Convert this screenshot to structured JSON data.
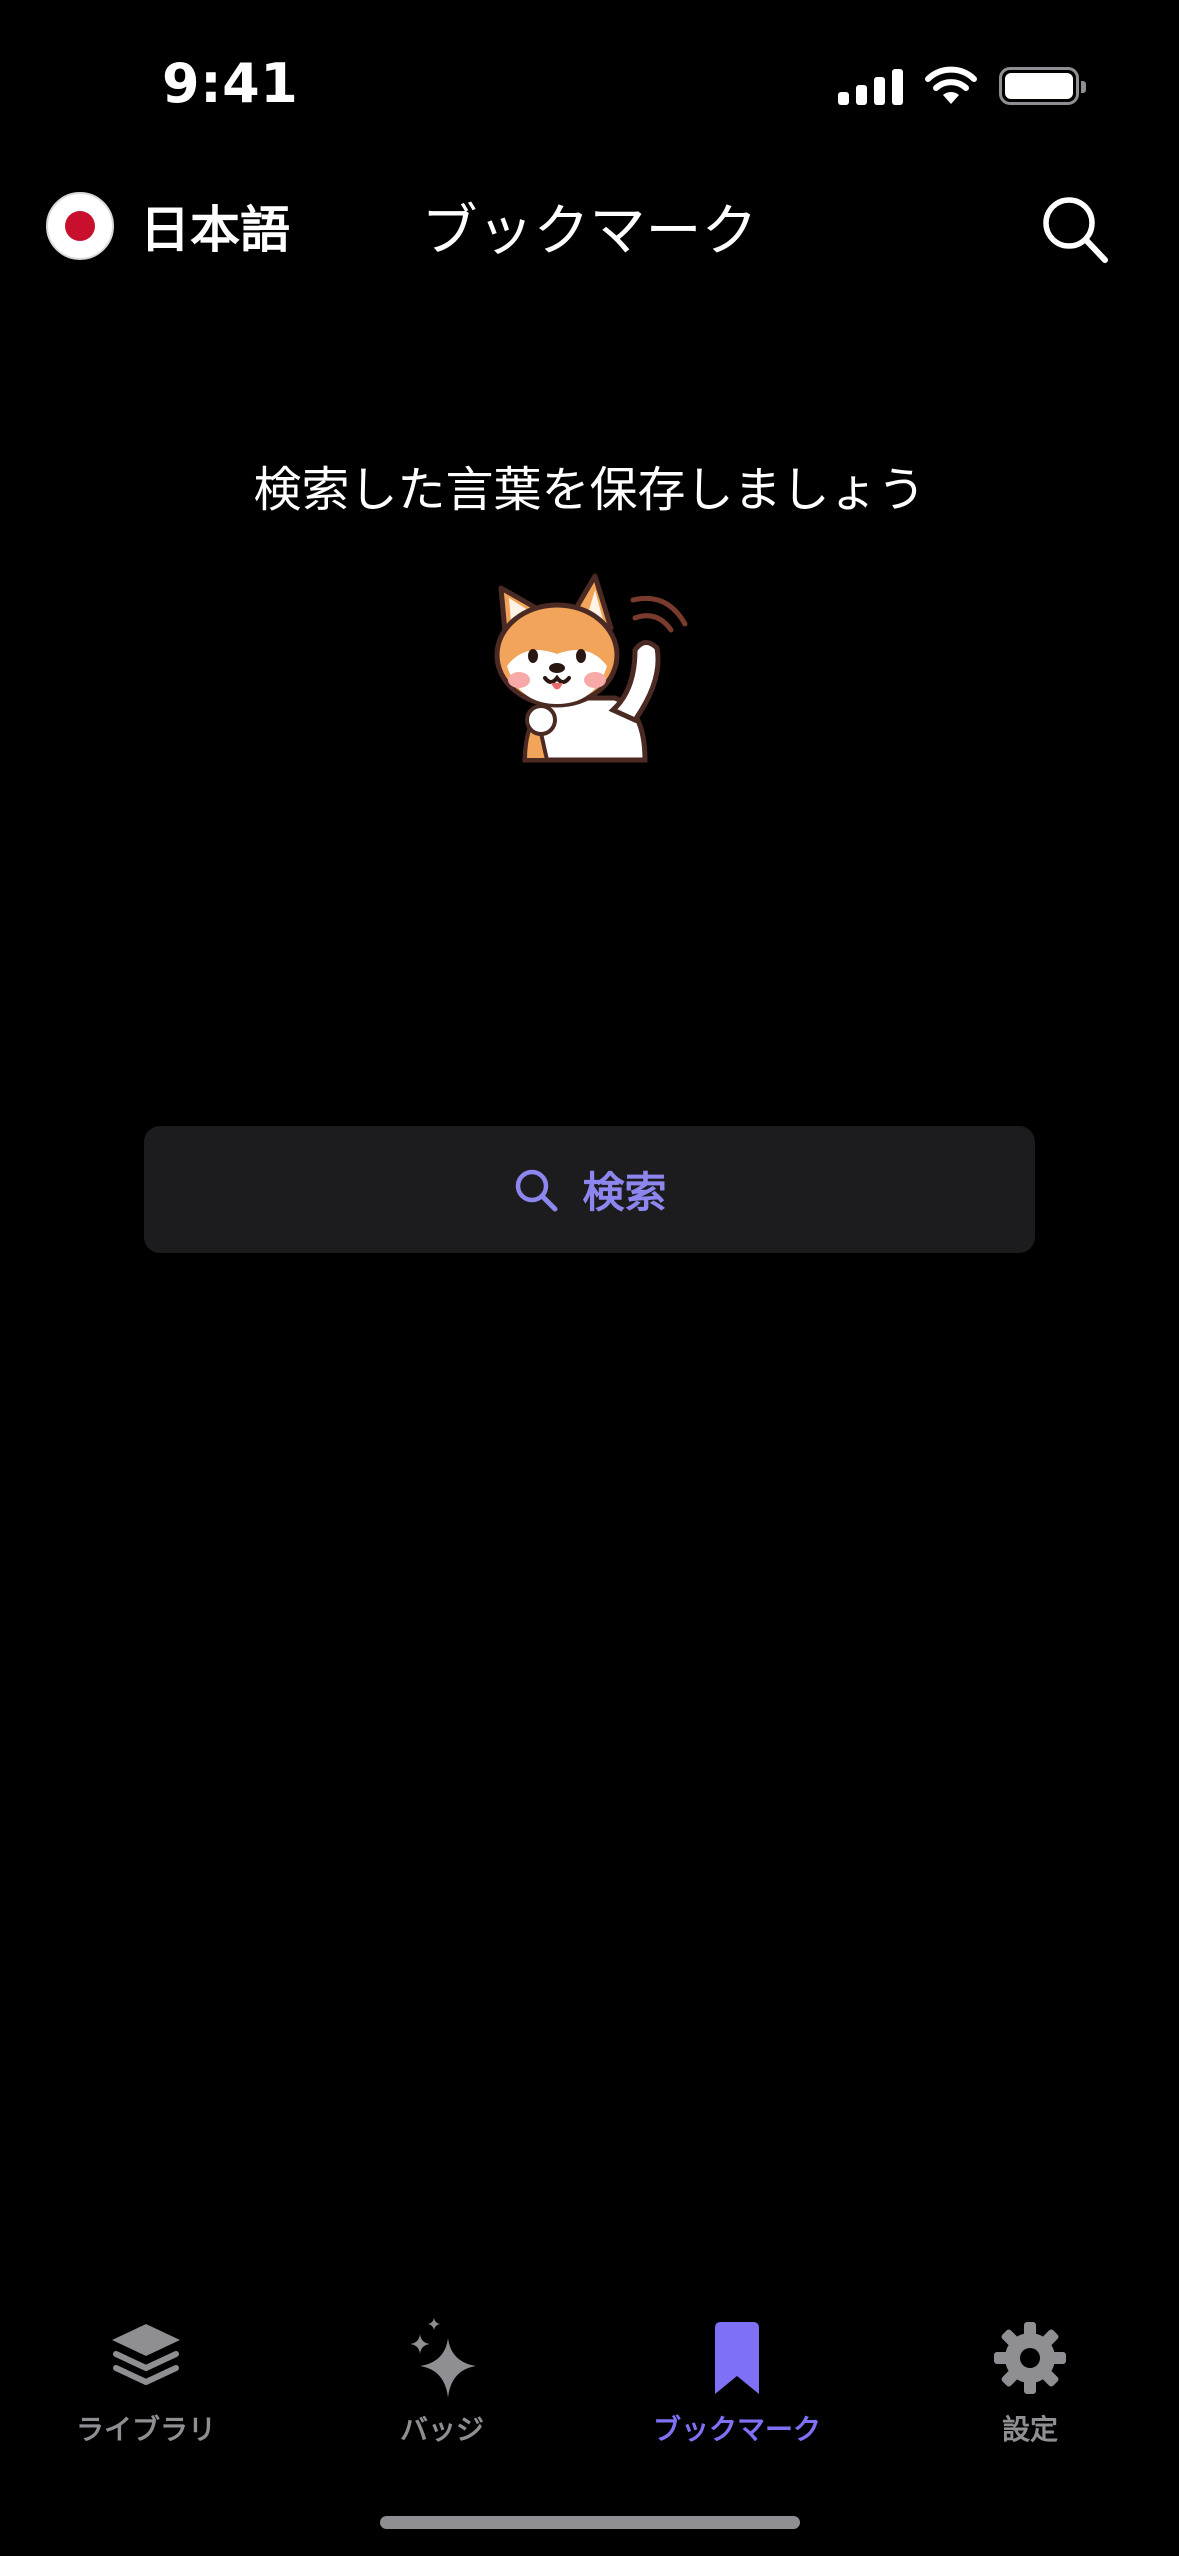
{
  "status_bar": {
    "time": "9:41"
  },
  "header": {
    "language_label": "日本語",
    "title": "ブックマーク"
  },
  "empty_state": {
    "message": "検索した言葉を保存しましょう",
    "mascot": "shiba-dog-waving"
  },
  "search_button": {
    "label": "検索"
  },
  "tabs": [
    {
      "label": "ライブラリ",
      "icon": "layers-icon",
      "active": false
    },
    {
      "label": "バッジ",
      "icon": "sparkles-icon",
      "active": false
    },
    {
      "label": "ブックマーク",
      "icon": "bookmark-icon",
      "active": true
    },
    {
      "label": "設定",
      "icon": "gear-icon",
      "active": false
    }
  ],
  "colors": {
    "accent": "#7f71f5",
    "inactive": "#8e8e93",
    "background": "#000000",
    "button_bg": "#1c1c1e"
  }
}
